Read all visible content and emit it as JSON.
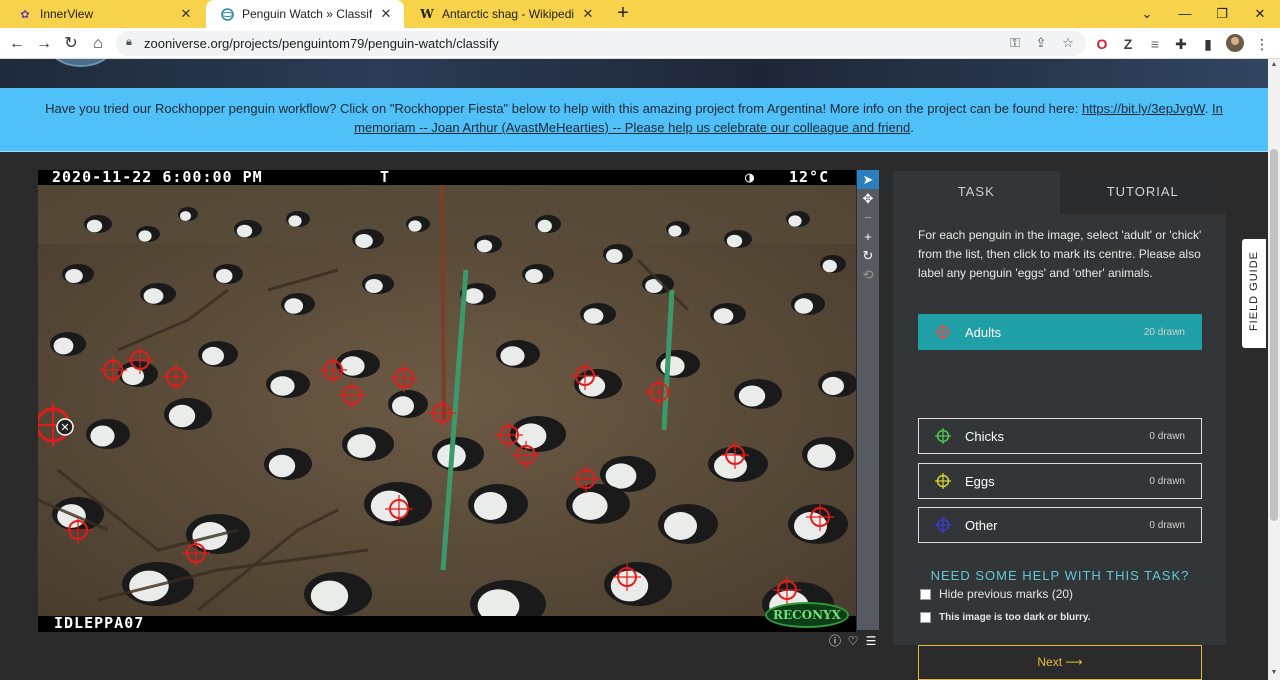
{
  "browser": {
    "tabs": [
      {
        "title": "InnerView",
        "icon": "innerview-favicon",
        "active": false
      },
      {
        "title": "Penguin Watch » Classify — Zooniverse",
        "icon": "zooniverse-favicon",
        "active": true
      },
      {
        "title": "Antarctic shag - Wikipedia",
        "icon": "wikipedia-favicon",
        "active": false
      }
    ],
    "new_tab": "+",
    "url": "zooniverse.org/projects/penguintom79/penguin-watch/classify"
  },
  "banner": {
    "text": "Have you tried our Rockhopper penguin workflow? Click on \"Rockhopper Fiesta\" below to help with this amazing project from Argentina! More info on the project can be found here: ",
    "link": "https://bit.ly/3epJvgW",
    "sep": ". ",
    "memoriam": "In memoriam -- Joan Arthur (AvastMeHearties) -- Please help us celebrate our colleague and friend",
    "end": "."
  },
  "subject": {
    "timestamp": "2020-11-22 6:00:00 PM",
    "marker": "T",
    "temperature": "12°C",
    "camera_id": "IDLEPPA07",
    "brand": "RECONYX"
  },
  "draw_tools": [
    {
      "name": "pointer-icon",
      "glyph": "➤"
    },
    {
      "name": "move-icon",
      "glyph": "✥"
    },
    {
      "name": "zoom-out-icon",
      "glyph": "−"
    },
    {
      "name": "zoom-in-icon",
      "glyph": "+"
    },
    {
      "name": "rotate-icon",
      "glyph": "↻"
    },
    {
      "name": "reset-icon",
      "glyph": "⟲"
    }
  ],
  "task_panel": {
    "tab_task": "TASK",
    "tab_tutorial": "TUTORIAL",
    "instructions": "For each penguin in the image, select 'adult' or 'chick' from the list, then click to mark its centre. Please also label any penguin 'eggs' and 'other' animals.",
    "tools": [
      {
        "label": "Adults",
        "count": "20 drawn",
        "color": "#e05050"
      },
      {
        "label": "Chicks",
        "count": "0 drawn",
        "color": "#4ed24e"
      },
      {
        "label": "Eggs",
        "count": "0 drawn",
        "color": "#d8d832"
      },
      {
        "label": "Other",
        "count": "0 drawn",
        "color": "#3a3ad8"
      }
    ],
    "help_title": "NEED SOME HELP WITH THIS TASK?",
    "hide_marks": "Hide previous marks (20)",
    "too_dark": "This image is too dark or blurry.",
    "next": "Next ⟶"
  },
  "field_guide": "FIELD GUIDE",
  "colors": {
    "banner": "#4fc0f8",
    "selected_tool": "#1fa0a7",
    "next_button": "#e7b93c",
    "tab_strip": "#f6d34a",
    "mark": "#e31c1c"
  }
}
